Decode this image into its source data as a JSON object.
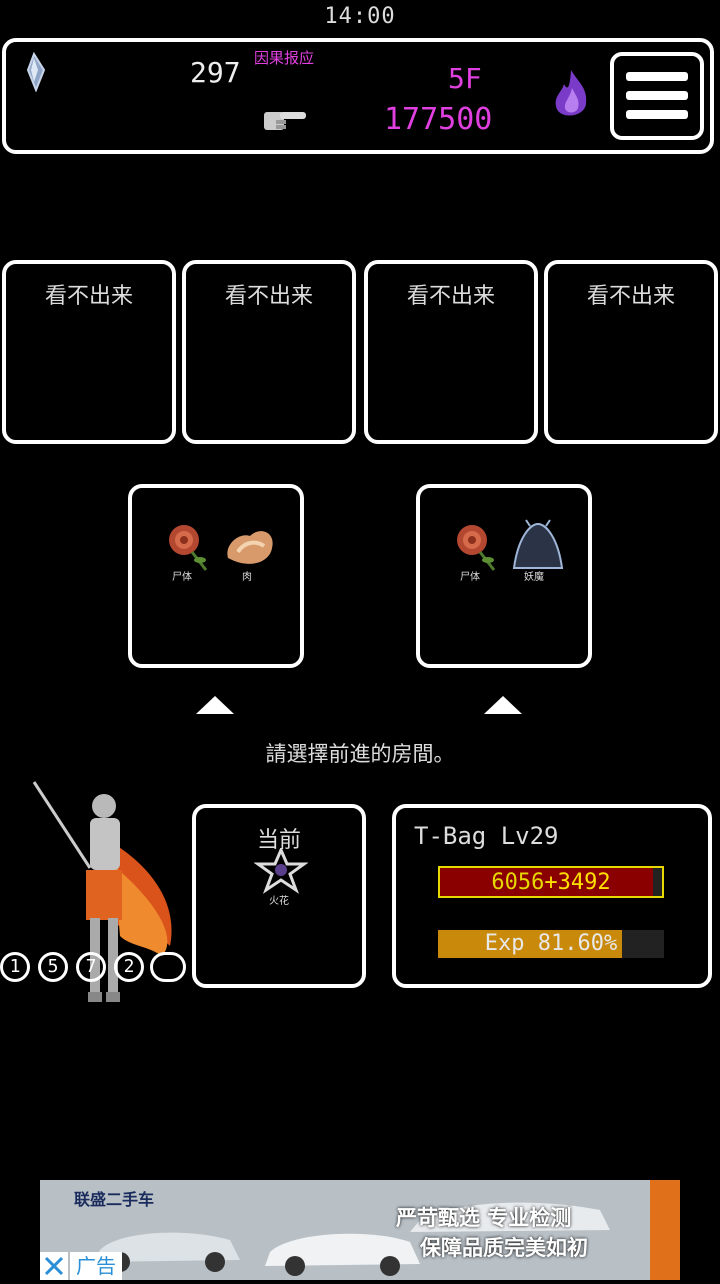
{
  "status_bar": {
    "time": "14:00"
  },
  "header": {
    "gold": "297",
    "karma_label": "因果报应",
    "floor": "5F",
    "score": "177500"
  },
  "unknown_rooms": [
    {
      "label": "看不出来"
    },
    {
      "label": "看不出来"
    },
    {
      "label": "看不出来"
    },
    {
      "label": "看不出来"
    }
  ],
  "door_options": [
    {
      "item1": "尸体",
      "item2": "肉"
    },
    {
      "item1": "尸体",
      "item2": "妖魔"
    }
  ],
  "prompt": "請選擇前進的房間。",
  "current": {
    "label": "当前",
    "item": "火花"
  },
  "player": {
    "name_level": "T-Bag Lv29",
    "hp_base": "6056",
    "hp_bonus": "+3492",
    "hp_fraction": 0.96,
    "exp_text": "Exp 81.60%",
    "exp_fraction": 0.816
  },
  "skill_slots": [
    "1",
    "5",
    "7",
    "2",
    ""
  ],
  "ad": {
    "brand": "联盛二手车",
    "slogan1": "严苛甄选 专业检测",
    "slogan2": "保障品质完美如初",
    "ad_label": "广告"
  },
  "colors": {
    "accent": "#e040e0",
    "hp": "#8a0000",
    "exp": "#c9890a",
    "border": "#ffffff"
  }
}
